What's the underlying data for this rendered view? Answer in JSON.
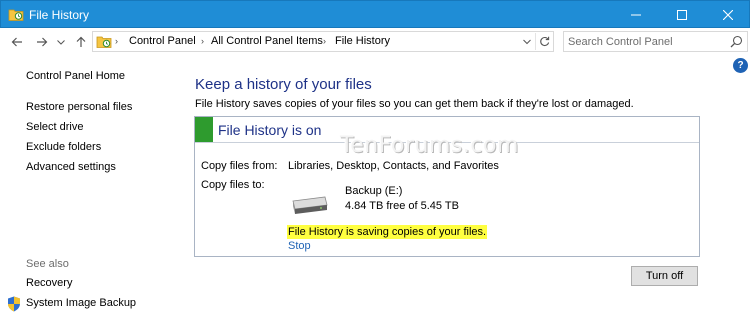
{
  "window": {
    "title": "File History"
  },
  "address": {
    "crumbs": [
      "Control Panel",
      "All Control Panel Items",
      "File History"
    ]
  },
  "search": {
    "placeholder": "Search Control Panel"
  },
  "help_label": "?",
  "sidebar": {
    "home": "Control Panel Home",
    "items": [
      {
        "label": "Restore personal files"
      },
      {
        "label": "Select drive"
      },
      {
        "label": "Exclude folders"
      },
      {
        "label": "Advanced settings"
      }
    ],
    "see_also_label": "See also",
    "see_also_items": [
      {
        "label": "Recovery"
      },
      {
        "label": "System Image Backup"
      }
    ]
  },
  "main": {
    "heading": "Keep a history of your files",
    "description": "File History saves copies of your files so you can get them back if they're lost or damaged.",
    "panel": {
      "title": "File History is on",
      "copy_from_label": "Copy files from:",
      "copy_from_value": "Libraries, Desktop, Contacts, and Favorites",
      "copy_to_label": "Copy files to:",
      "drive_name": "Backup (E:)",
      "drive_free": "4.84 TB free of 5.45 TB",
      "status_message": "File History is saving copies of your files.",
      "stop_label": "Stop"
    },
    "turn_off_label": "Turn off"
  },
  "watermark": "TenForums.com",
  "colors": {
    "titlebar": "#1f8dd6",
    "heading": "#1e3287",
    "status_on": "#2e9b2e",
    "highlight": "#ffff40",
    "link": "#1f63b5"
  }
}
